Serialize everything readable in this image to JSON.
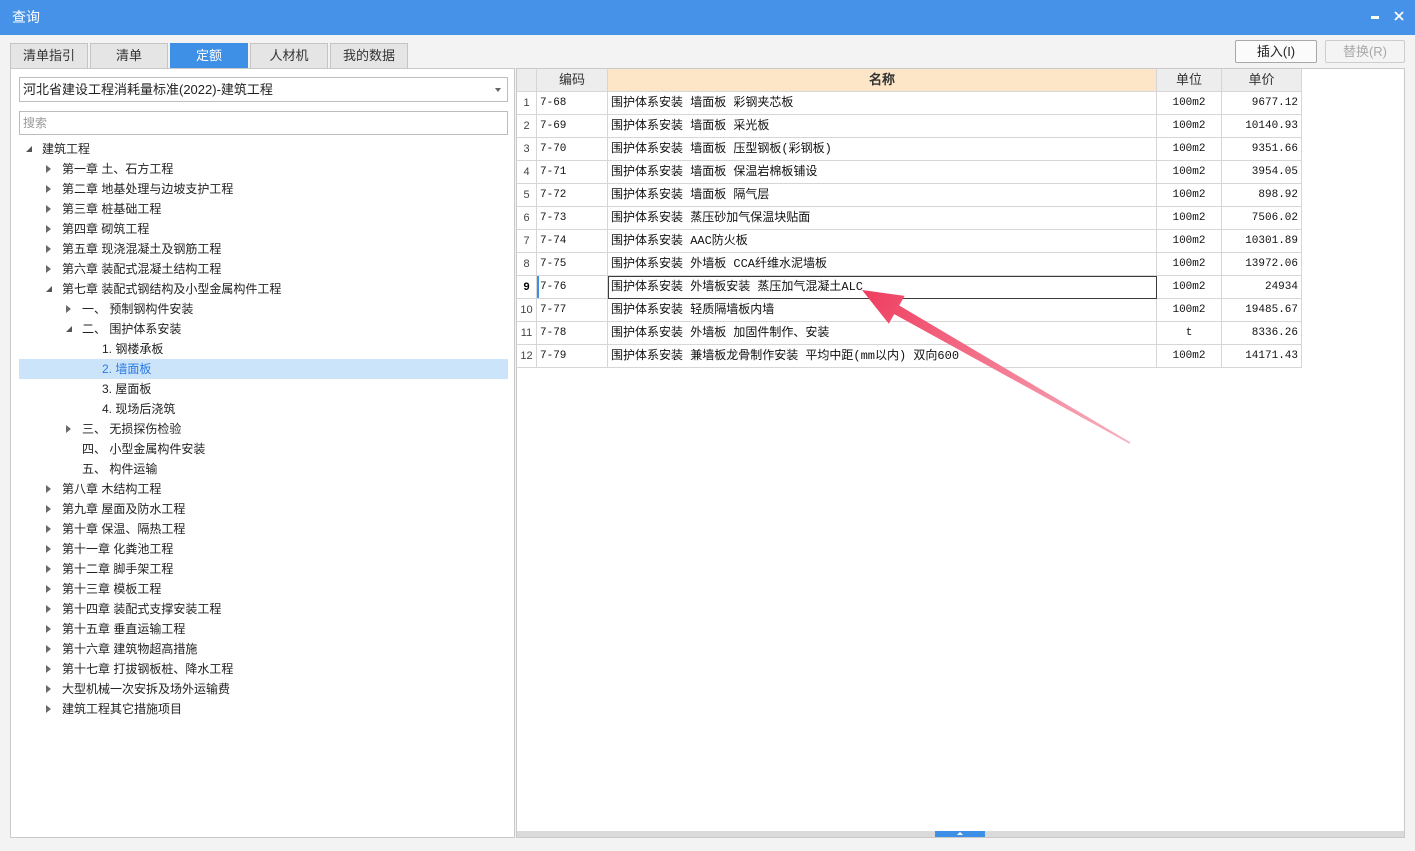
{
  "window": {
    "title": "查询",
    "minimize_icon": "minimize-icon",
    "close_icon": "close-icon"
  },
  "tabs": [
    {
      "label": "清单指引",
      "active": false
    },
    {
      "label": "清单",
      "active": false
    },
    {
      "label": "定额",
      "active": true
    },
    {
      "label": "人材机",
      "active": false
    },
    {
      "label": "我的数据",
      "active": false
    }
  ],
  "actions": {
    "insert_label": "插入(I)",
    "replace_label": "替换(R)",
    "replace_disabled": true
  },
  "left": {
    "library_select": {
      "value": "河北省建设工程消耗量标准(2022)-建筑工程",
      "icon": "chevron-down-icon"
    },
    "search": {
      "placeholder": "搜索"
    },
    "tree": [
      {
        "label": "建筑工程",
        "expanded": true,
        "children": [
          {
            "label": "第一章 土、石方工程",
            "expanded": false
          },
          {
            "label": "第二章 地基处理与边坡支护工程",
            "expanded": false
          },
          {
            "label": "第三章 桩基础工程",
            "expanded": false
          },
          {
            "label": "第四章 砌筑工程",
            "expanded": false
          },
          {
            "label": "第五章 现浇混凝土及钢筋工程",
            "expanded": false
          },
          {
            "label": "第六章 装配式混凝土结构工程",
            "expanded": false
          },
          {
            "label": "第七章 装配式钢结构及小型金属构件工程",
            "expanded": true,
            "children": [
              {
                "label": "一、 预制钢构件安装",
                "expanded": false
              },
              {
                "label": "二、 围护体系安装",
                "expanded": true,
                "children": [
                  {
                    "label": "1. 钢楼承板",
                    "leaf": true
                  },
                  {
                    "label": "2. 墙面板",
                    "leaf": true,
                    "selected": true
                  },
                  {
                    "label": "3. 屋面板",
                    "leaf": true
                  },
                  {
                    "label": "4. 现场后浇筑",
                    "leaf": true
                  }
                ]
              },
              {
                "label": "三、 无损探伤检验",
                "expanded": false
              },
              {
                "label": "四、 小型金属构件安装",
                "leaf": true
              },
              {
                "label": "五、 构件运输",
                "leaf": true
              }
            ]
          },
          {
            "label": "第八章 木结构工程",
            "expanded": false
          },
          {
            "label": "第九章 屋面及防水工程",
            "expanded": false
          },
          {
            "label": "第十章 保温、隔热工程",
            "expanded": false
          },
          {
            "label": "第十一章 化粪池工程",
            "expanded": false
          },
          {
            "label": "第十二章 脚手架工程",
            "expanded": false
          },
          {
            "label": "第十三章 模板工程",
            "expanded": false
          },
          {
            "label": "第十四章 装配式支撑安装工程",
            "expanded": false
          },
          {
            "label": "第十五章 垂直运输工程",
            "expanded": false
          },
          {
            "label": "第十六章 建筑物超高措施",
            "expanded": false
          },
          {
            "label": "第十七章 打拔钢板桩、降水工程",
            "expanded": false
          },
          {
            "label": "大型机械一次安拆及场外运输费",
            "expanded": false
          },
          {
            "label": "建筑工程其它措施项目",
            "expanded": false
          }
        ]
      }
    ]
  },
  "grid": {
    "columns": {
      "code": "编码",
      "name": "名称",
      "unit": "单位",
      "price": "单价"
    },
    "rows": [
      {
        "no": 1,
        "code": "7-68",
        "name": "围护体系安装 墙面板 彩钢夹芯板",
        "unit": "100m2",
        "price": "9677.12"
      },
      {
        "no": 2,
        "code": "7-69",
        "name": "围护体系安装 墙面板 采光板",
        "unit": "100m2",
        "price": "10140.93"
      },
      {
        "no": 3,
        "code": "7-70",
        "name": "围护体系安装 墙面板 压型钢板(彩钢板)",
        "unit": "100m2",
        "price": "9351.66"
      },
      {
        "no": 4,
        "code": "7-71",
        "name": "围护体系安装 墙面板 保温岩棉板铺设",
        "unit": "100m2",
        "price": "3954.05"
      },
      {
        "no": 5,
        "code": "7-72",
        "name": "围护体系安装 墙面板 隔气层",
        "unit": "100m2",
        "price": "898.92"
      },
      {
        "no": 6,
        "code": "7-73",
        "name": "围护体系安装 蒸压砂加气保温块贴面",
        "unit": "100m2",
        "price": "7506.02"
      },
      {
        "no": 7,
        "code": "7-74",
        "name": "围护体系安装 AAC防火板",
        "unit": "100m2",
        "price": "10301.89"
      },
      {
        "no": 8,
        "code": "7-75",
        "name": "围护体系安装 外墙板 CCA纤维水泥墙板",
        "unit": "100m2",
        "price": "13972.06"
      },
      {
        "no": 9,
        "code": "7-76",
        "name": "围护体系安装 外墙板安装 蒸压加气混凝土ALC",
        "unit": "100m2",
        "price": "24934",
        "selected": true
      },
      {
        "no": 10,
        "code": "7-77",
        "name": "围护体系安装 轻质隔墙板内墙",
        "unit": "100m2",
        "price": "19485.67"
      },
      {
        "no": 11,
        "code": "7-78",
        "name": "围护体系安装 外墙板 加固件制作、安装",
        "unit": "t",
        "price": "8336.26"
      },
      {
        "no": 12,
        "code": "7-79",
        "name": "围护体系安装 兼墙板龙骨制作安装 平均中距(mm以内) 双向600",
        "unit": "100m2",
        "price": "14171.43"
      }
    ]
  },
  "icons": {
    "expanded": "expanded-arrow-icon",
    "collapsed": "collapsed-arrow-icon",
    "splitter": "chevron-up-icon"
  },
  "colors": {
    "titlebar": "#4592e8",
    "accent": "#3e8fe6",
    "selection": "#cce4fa",
    "selection_text": "#2a7ae0",
    "header_highlight": "#fde6c8",
    "annotation_arrow": "#ef3d5f"
  }
}
